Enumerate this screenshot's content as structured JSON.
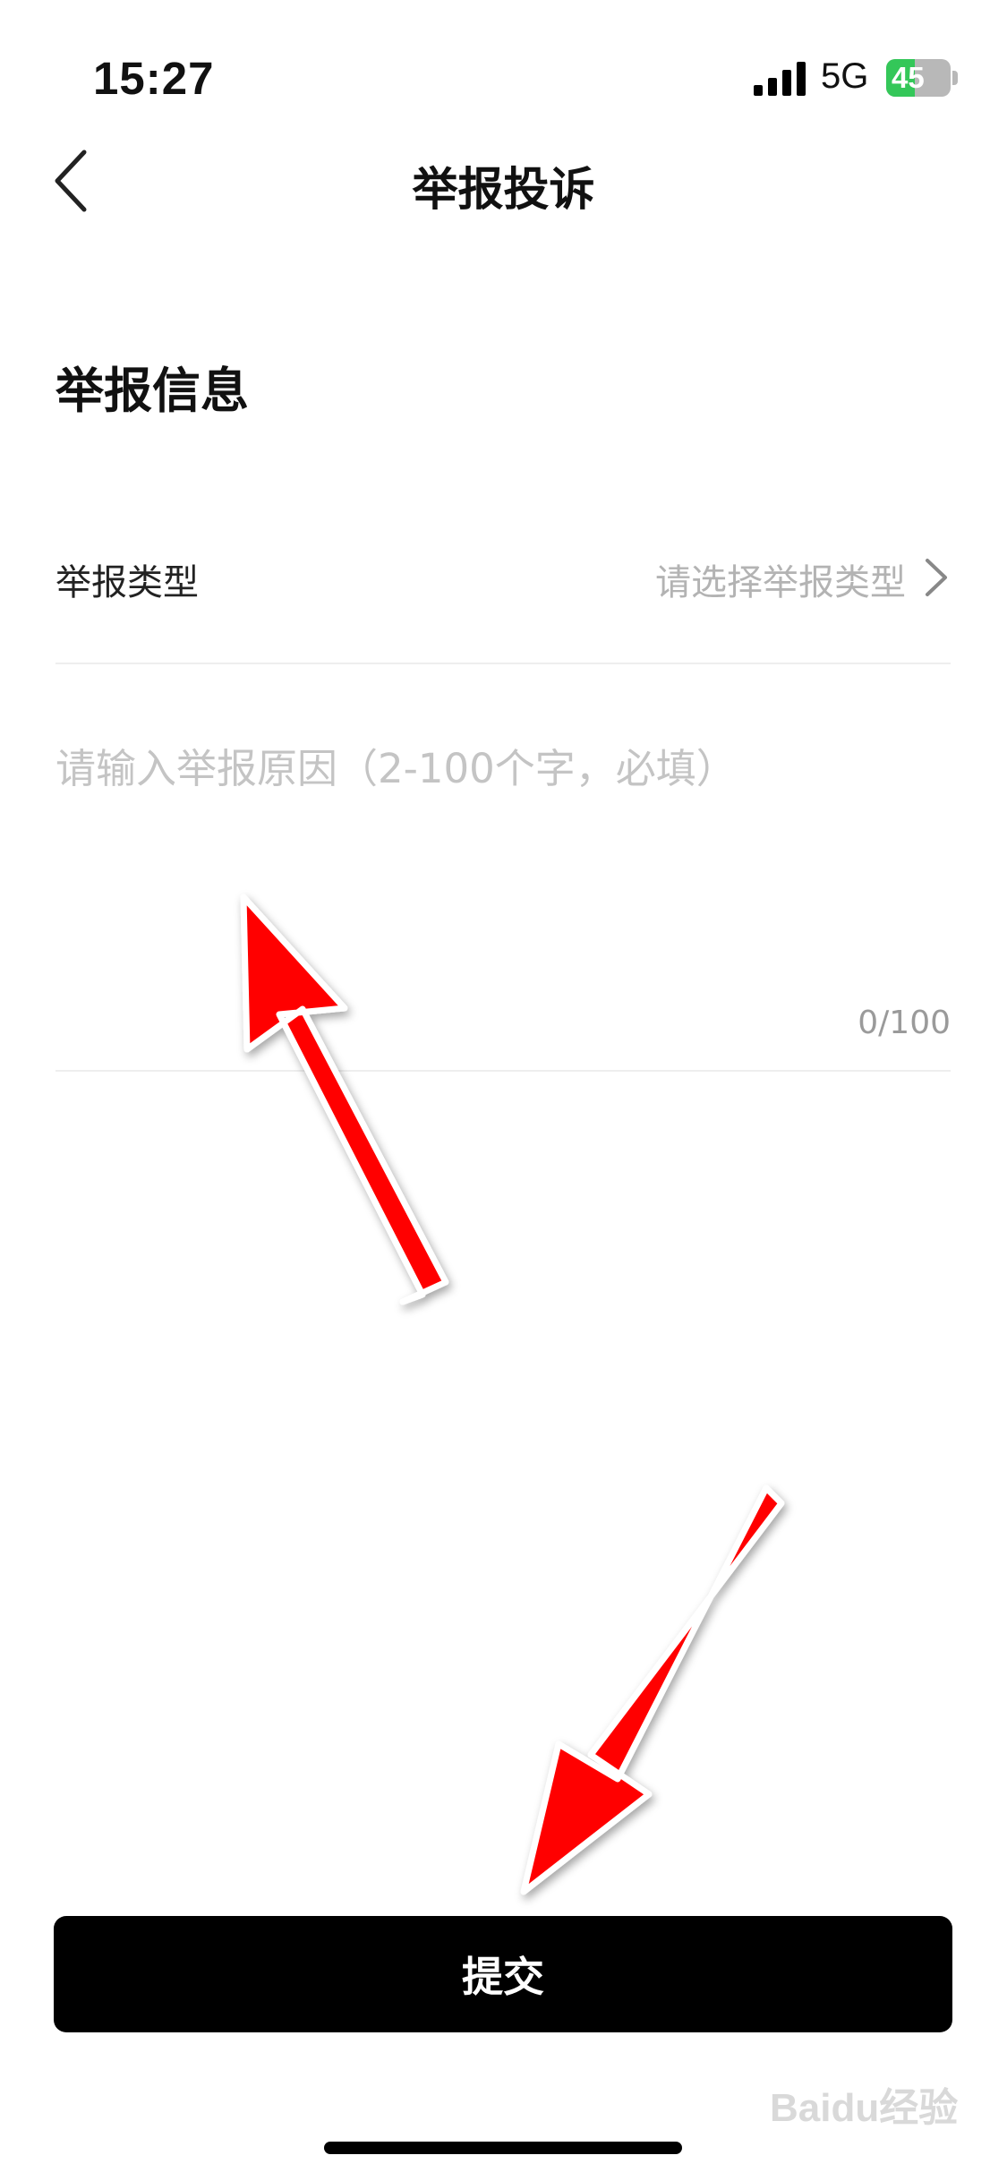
{
  "status_bar": {
    "time": "15:27",
    "network": "5G",
    "battery": "45",
    "battery_level": 0.45,
    "battery_color": "#34c759"
  },
  "nav": {
    "back_icon": "chevron-left-icon",
    "title": "举报投诉"
  },
  "section": {
    "title": "举报信息"
  },
  "report_type": {
    "label": "举报类型",
    "value": "请选择举报类型",
    "icon": "chevron-right-icon"
  },
  "reason": {
    "placeholder": "请输入举报原因（2-100个字，必填）",
    "value": "",
    "count": "0/100"
  },
  "submit": {
    "label": "提交"
  },
  "watermark": "Baidu经验",
  "annotation_color": "#ff0000"
}
